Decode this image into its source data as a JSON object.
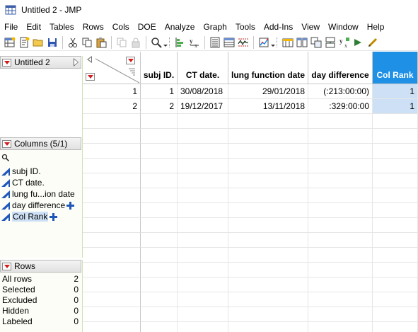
{
  "window": {
    "title": "Untitled 2 - JMP"
  },
  "menu": [
    "File",
    "Edit",
    "Tables",
    "Rows",
    "Cols",
    "DOE",
    "Analyze",
    "Graph",
    "Tools",
    "Add-Ins",
    "View",
    "Window",
    "Help"
  ],
  "toolbar": {
    "icons": [
      "new-data-table-icon",
      "new-script-icon",
      "open-icon",
      "save-icon",
      "cut-icon",
      "copy-icon",
      "paste-icon",
      "copy-disabled-icon",
      "lock-disabled-icon",
      "search-icon",
      "distribution-icon",
      "fit-y-by-x-icon",
      "data-table-icon",
      "summary-icon",
      "control-chart-icon",
      "graph-builder-icon",
      "tables-icon",
      "split-icon",
      "join-icon",
      "stack-icon",
      "fit-model-icon",
      "script-icon",
      "edit-icon"
    ]
  },
  "left_panel": {
    "table_name": "Untitled 2",
    "columns_header": "Columns (5/1)",
    "columns": [
      {
        "label": "subj ID.",
        "selected": false,
        "has_plus": false
      },
      {
        "label": "CT date.",
        "selected": false,
        "has_plus": false
      },
      {
        "label": "lung fu...ion date",
        "selected": false,
        "has_plus": false
      },
      {
        "label": "day difference",
        "selected": false,
        "has_plus": true
      },
      {
        "label": "Col Rank",
        "selected": true,
        "has_plus": true
      }
    ],
    "rows_header": "Rows",
    "rows_stats": [
      {
        "label": "All rows",
        "value": "2"
      },
      {
        "label": "Selected",
        "value": "0"
      },
      {
        "label": "Excluded",
        "value": "0"
      },
      {
        "label": "Hidden",
        "value": "0"
      },
      {
        "label": "Labeled",
        "value": "0"
      }
    ]
  },
  "grid": {
    "headers": [
      "subj ID.",
      "CT date.",
      "lung function date",
      "day difference",
      "Col Rank"
    ],
    "selected_column": "Col Rank",
    "rows": [
      {
        "num": "1",
        "cells": [
          "1",
          "30/08/2018",
          "29/01/2018",
          "(:213:00:00)",
          "1"
        ]
      },
      {
        "num": "2",
        "cells": [
          "2",
          "19/12/2017",
          "13/11/2018",
          ":329:00:00",
          "1"
        ]
      }
    ]
  },
  "colors": {
    "selected_header": "#1e90e6",
    "selected_cells": "#cde0f5",
    "accent_red": "#d21e1e",
    "column_icon_blue": "#1f57b8"
  }
}
